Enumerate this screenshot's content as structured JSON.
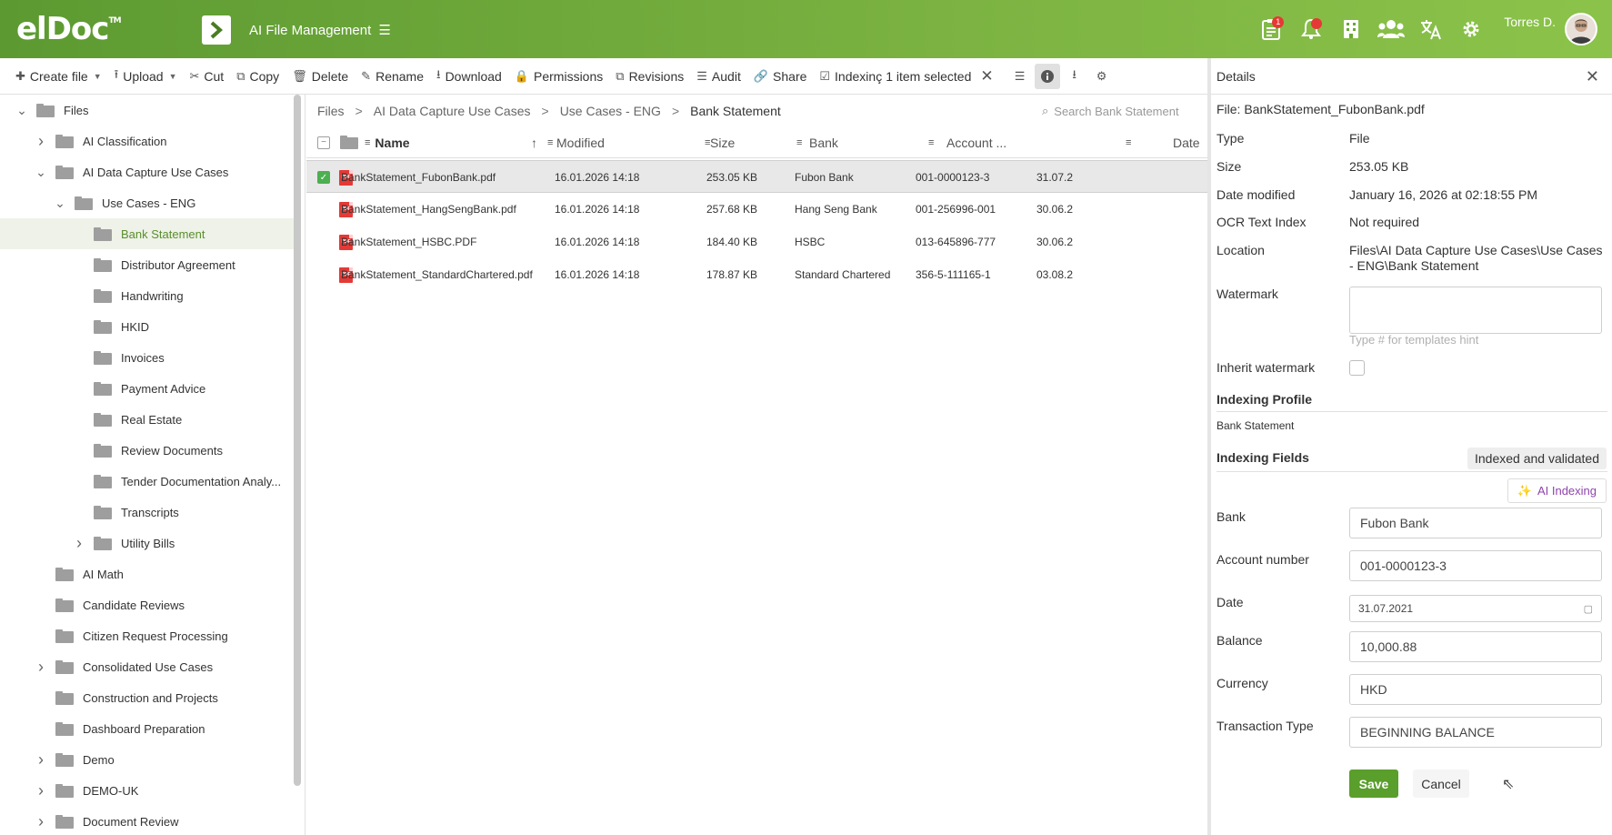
{
  "header": {
    "logo": "elDoc",
    "logo_tm": "TM",
    "app_title": "AI File Management",
    "notifications_badge": "1",
    "user_name": "Torres D."
  },
  "toolbar": {
    "create_file": "Create file",
    "upload": "Upload",
    "cut": "Cut",
    "copy": "Copy",
    "delete": "Delete",
    "rename": "Rename",
    "download": "Download",
    "permissions": "Permissions",
    "revisions": "Revisions",
    "audit": "Audit",
    "share": "Share",
    "indexing": "Indexinç",
    "selection_text": "1 item selected"
  },
  "tree": {
    "items": [
      {
        "label": "Files",
        "indent": 0,
        "chev": "v"
      },
      {
        "label": "AI Classification",
        "indent": 1,
        "chev": ">"
      },
      {
        "label": "AI Data Capture Use Cases",
        "indent": 1,
        "chev": "v"
      },
      {
        "label": "Use Cases - ENG",
        "indent": 2,
        "chev": "v"
      },
      {
        "label": "Bank Statement",
        "indent": 3,
        "chev": "",
        "selected": true
      },
      {
        "label": "Distributor Agreement",
        "indent": 3,
        "chev": ""
      },
      {
        "label": "Handwriting",
        "indent": 3,
        "chev": ""
      },
      {
        "label": "HKID",
        "indent": 3,
        "chev": ""
      },
      {
        "label": "Invoices",
        "indent": 3,
        "chev": ""
      },
      {
        "label": "Payment Advice",
        "indent": 3,
        "chev": ""
      },
      {
        "label": "Real Estate",
        "indent": 3,
        "chev": ""
      },
      {
        "label": "Review Documents",
        "indent": 3,
        "chev": ""
      },
      {
        "label": "Tender Documentation Analy...",
        "indent": 3,
        "chev": ""
      },
      {
        "label": "Transcripts",
        "indent": 3,
        "chev": ""
      },
      {
        "label": "Utility Bills",
        "indent": 3,
        "chev": ">"
      },
      {
        "label": "AI Math",
        "indent": 1,
        "chev": ""
      },
      {
        "label": "Candidate Reviews",
        "indent": 1,
        "chev": ""
      },
      {
        "label": "Citizen Request Processing",
        "indent": 1,
        "chev": ""
      },
      {
        "label": "Consolidated Use Cases",
        "indent": 1,
        "chev": ">"
      },
      {
        "label": "Construction and Projects",
        "indent": 1,
        "chev": ""
      },
      {
        "label": "Dashboard Preparation",
        "indent": 1,
        "chev": ""
      },
      {
        "label": "Demo",
        "indent": 1,
        "chev": ">"
      },
      {
        "label": "DEMO-UK",
        "indent": 1,
        "chev": ">"
      },
      {
        "label": "Document Review",
        "indent": 1,
        "chev": ">"
      }
    ]
  },
  "breadcrumb": {
    "items": [
      "Files",
      "AI Data Capture Use Cases",
      "Use Cases - ENG",
      "Bank Statement"
    ],
    "search_placeholder": "Search Bank Statement"
  },
  "grid": {
    "columns": {
      "name": "Name",
      "modified": "Modified",
      "size": "Size",
      "bank": "Bank",
      "account": "Account ...",
      "date": "Date"
    },
    "rows": [
      {
        "name": "BankStatement_FubonBank.pdf",
        "modified": "16.01.2026 14:18",
        "size": "253.05 KB",
        "bank": "Fubon Bank",
        "account": "001-0000123-3",
        "date": "31.07.2",
        "selected": true
      },
      {
        "name": "BankStatement_HangSengBank.pdf",
        "modified": "16.01.2026 14:18",
        "size": "257.68 KB",
        "bank": "Hang Seng Bank",
        "account": "001-256996-001",
        "date": "30.06.2"
      },
      {
        "name": "BankStatement_HSBC.PDF",
        "modified": "16.01.2026 14:18",
        "size": "184.40 KB",
        "bank": "HSBC",
        "account": "013-645896-777",
        "date": "30.06.2"
      },
      {
        "name": "BankStatement_StandardChartered.pdf",
        "modified": "16.01.2026 14:18",
        "size": "178.87 KB",
        "bank": "Standard Chartered",
        "account": "356-5-111165-1",
        "date": "03.08.2"
      }
    ]
  },
  "details": {
    "title": "Details",
    "file_line": "File: BankStatement_FubonBank.pdf",
    "props": {
      "type_label": "Type",
      "type_value": "File",
      "size_label": "Size",
      "size_value": "253.05 KB",
      "modified_label": "Date modified",
      "modified_value": "January 16, 2026 at 02:18:55 PM",
      "ocr_label": "OCR Text Index",
      "ocr_value": "Not required",
      "location_label": "Location",
      "location_value": "Files\\AI Data Capture Use Cases\\Use Cases - ENG\\Bank Statement",
      "watermark_label": "Watermark",
      "watermark_hint": "Type # for templates hint",
      "inherit_label": "Inherit watermark"
    },
    "indexing_profile_title": "Indexing Profile",
    "indexing_profile_value": "Bank Statement",
    "indexing_fields_title": "Indexing Fields",
    "indexing_status": "Indexed and validated",
    "ai_indexing": "AI Indexing",
    "fields": {
      "bank_label": "Bank",
      "bank_value": "Fubon Bank",
      "account_label": "Account number",
      "account_value": "001-0000123-3",
      "date_label": "Date",
      "date_value": "31.07.2021",
      "balance_label": "Balance",
      "balance_value": "10,000.88",
      "currency_label": "Currency",
      "currency_value": "HKD",
      "ttype_label": "Transaction Type",
      "ttype_value": "BEGINNING BALANCE"
    },
    "save": "Save",
    "cancel": "Cancel"
  },
  "colors": {
    "brand": "#6aa834",
    "selected_tree": "#eef2e8",
    "save": "#5a9e2c",
    "pdf": "#e53935",
    "ai": "#8e44ad"
  }
}
